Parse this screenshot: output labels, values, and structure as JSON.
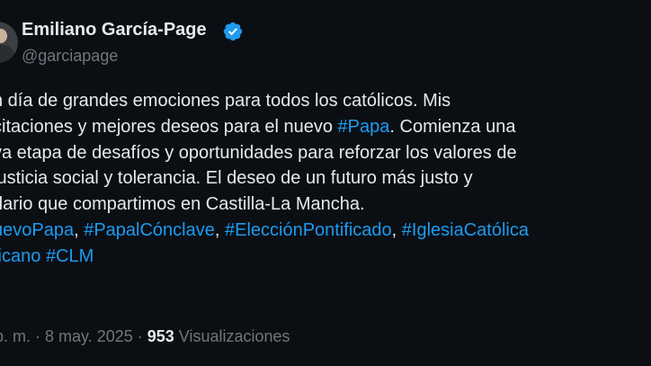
{
  "author": {
    "name": "Emiliano García-Page",
    "handle": "@garciapage",
    "verified_icon": "verified-badge-icon"
  },
  "tweet": {
    "lines": [
      [
        {
          "t": "n día de grandes emociones para todos los católicos. Mis"
        }
      ],
      [
        {
          "t": "citaciones y mejores deseos para el nuevo "
        },
        {
          "t": "#Papa",
          "tag": true
        },
        {
          "t": ". Comienza una"
        }
      ],
      [
        {
          "t": "va etapa de desafíos y oportunidades para reforzar los valores de"
        }
      ],
      [
        {
          "t": "justicia social y tolerancia. El deseo de un futuro más justo y"
        }
      ],
      [
        {
          "t": "dario que compartimos en Castilla-La Mancha."
        }
      ],
      [
        {
          "t": "uevoPapa",
          "tag": true
        },
        {
          "t": ", "
        },
        {
          "t": "#PapalCónclave",
          "tag": true
        },
        {
          "t": ", "
        },
        {
          "t": "#ElecciónPontificado",
          "tag": true
        },
        {
          "t": ", "
        },
        {
          "t": "#IglesiaCatólica",
          "tag": true
        }
      ],
      [
        {
          "t": "ticano",
          "tag": true
        },
        {
          "t": " "
        },
        {
          "t": "#CLM",
          "tag": true
        }
      ]
    ]
  },
  "meta": {
    "time": "p. m.",
    "sep1": " · ",
    "date": "8 may. 2025",
    "sep2": " · ",
    "views_count": "953",
    "views_label": " Visualizaciones"
  },
  "colors": {
    "background": "#0b0f14",
    "text": "#e7e9ea",
    "muted": "#71767b",
    "accent": "#1d9bf0"
  }
}
